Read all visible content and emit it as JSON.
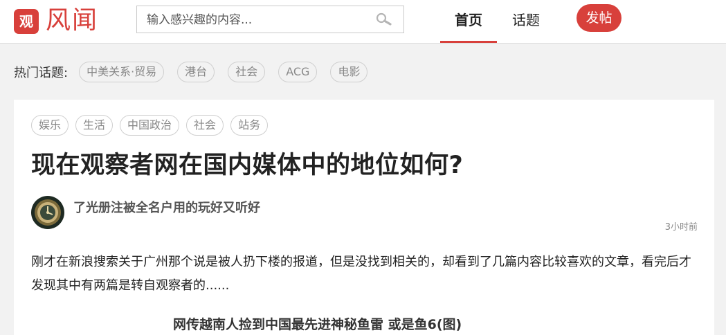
{
  "header": {
    "logo_glyph": "观",
    "site_name": "风闻",
    "search": {
      "placeholder": "输入感兴趣的内容..."
    },
    "nav": [
      {
        "label": "首页",
        "active": true
      },
      {
        "label": "话题",
        "active": false
      }
    ],
    "post_button": "发帖",
    "accent_color": "#d8403b"
  },
  "hot_topics": {
    "label": "热门话题:",
    "items": [
      "中美关系·贸易",
      "港台",
      "社会",
      "ACG",
      "电影"
    ]
  },
  "article": {
    "tags": [
      "娱乐",
      "生活",
      "中国政治",
      "社会",
      "站务"
    ],
    "title": "现在观察者网在国内媒体中的地位如何?",
    "author": "了光册注被全名户用的玩好又听好",
    "time": "3小时前",
    "excerpt": "刚才在新浪搜索关于广州那个说是被人扔下楼的报道，但是没找到相关的，却看到了几篇内容比较喜欢的文章，看完后才发现其中有两篇是转自观察者的......",
    "image_caption": "网传越南人捡到中国最先进神秘鱼雷 或是鱼6(图)"
  }
}
